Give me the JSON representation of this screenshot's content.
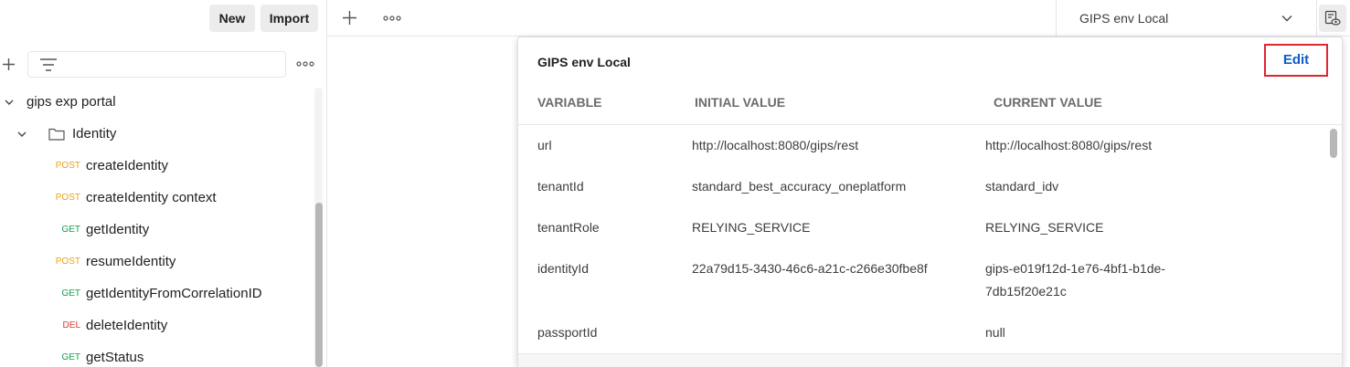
{
  "sidebar": {
    "new_label": "New",
    "import_label": "Import",
    "collection_name": "gips exp portal",
    "folder_name": "Identity",
    "requests": [
      {
        "method": "POST",
        "name": "createIdentity",
        "method_type": "post"
      },
      {
        "method": "POST",
        "name": "createIdentity context",
        "method_type": "post"
      },
      {
        "method": "GET",
        "name": "getIdentity",
        "method_type": "get"
      },
      {
        "method": "POST",
        "name": "resumeIdentity",
        "method_type": "post"
      },
      {
        "method": "GET",
        "name": "getIdentityFromCorrelationID",
        "method_type": "get"
      },
      {
        "method": "DEL",
        "name": "deleteIdentity",
        "method_type": "del"
      },
      {
        "method": "GET",
        "name": "getStatus",
        "method_type": "get"
      }
    ]
  },
  "topbar": {
    "environment_selected": "GIPS env Local"
  },
  "env_popover": {
    "title": "GIPS env Local",
    "edit_label": "Edit",
    "columns": {
      "variable": "VARIABLE",
      "initial": "INITIAL VALUE",
      "current": "CURRENT VALUE"
    },
    "rows": [
      {
        "variable": "url",
        "initial": "http://localhost:8080/gips/rest",
        "current": "http://localhost:8080/gips/rest",
        "current_line2": ""
      },
      {
        "variable": "tenantId",
        "initial": "standard_best_accuracy_oneplatform",
        "current": "standard_idv",
        "current_line2": ""
      },
      {
        "variable": "tenantRole",
        "initial": "RELYING_SERVICE",
        "current": "RELYING_SERVICE",
        "current_line2": ""
      },
      {
        "variable": "identityId",
        "initial": "22a79d15-3430-46c6-a21c-c266e30fbe8f",
        "current": "gips-e019f12d-1e76-4bf1-b1de-",
        "current_line2": "7db15f20e21c"
      },
      {
        "variable": "passportId",
        "initial": "",
        "current": "null",
        "current_line2": ""
      }
    ]
  },
  "colors": {
    "post": "#e8a317",
    "get": "#0ca24a",
    "del": "#d83a2e",
    "edit_text": "#0b5cc7",
    "edit_border": "#e0262f"
  }
}
